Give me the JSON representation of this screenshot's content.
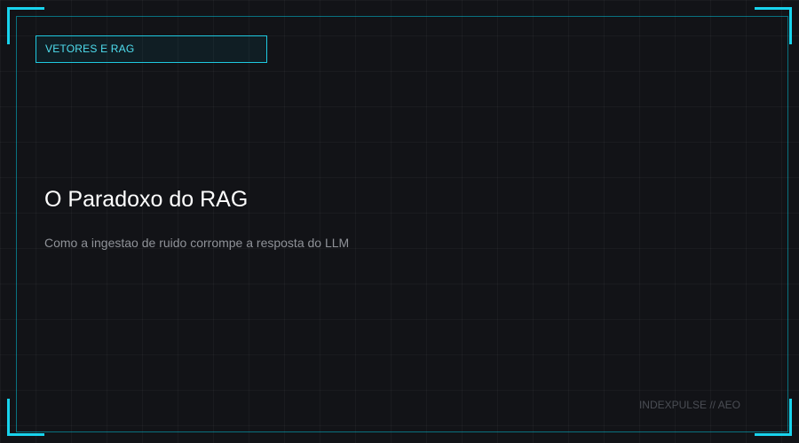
{
  "card": {
    "tag": "VETORES E RAG",
    "title": "O Paradoxo do RAG",
    "subtitle": "Como a ingestao de ruido corrompe a resposta do LLM",
    "footer": "INDEXPULSE // AEO"
  },
  "colors": {
    "background": "#121317",
    "accent": "#18d4ee",
    "title": "#ffffff",
    "subtitle": "#8f9298",
    "footer": "#4a4d54"
  }
}
